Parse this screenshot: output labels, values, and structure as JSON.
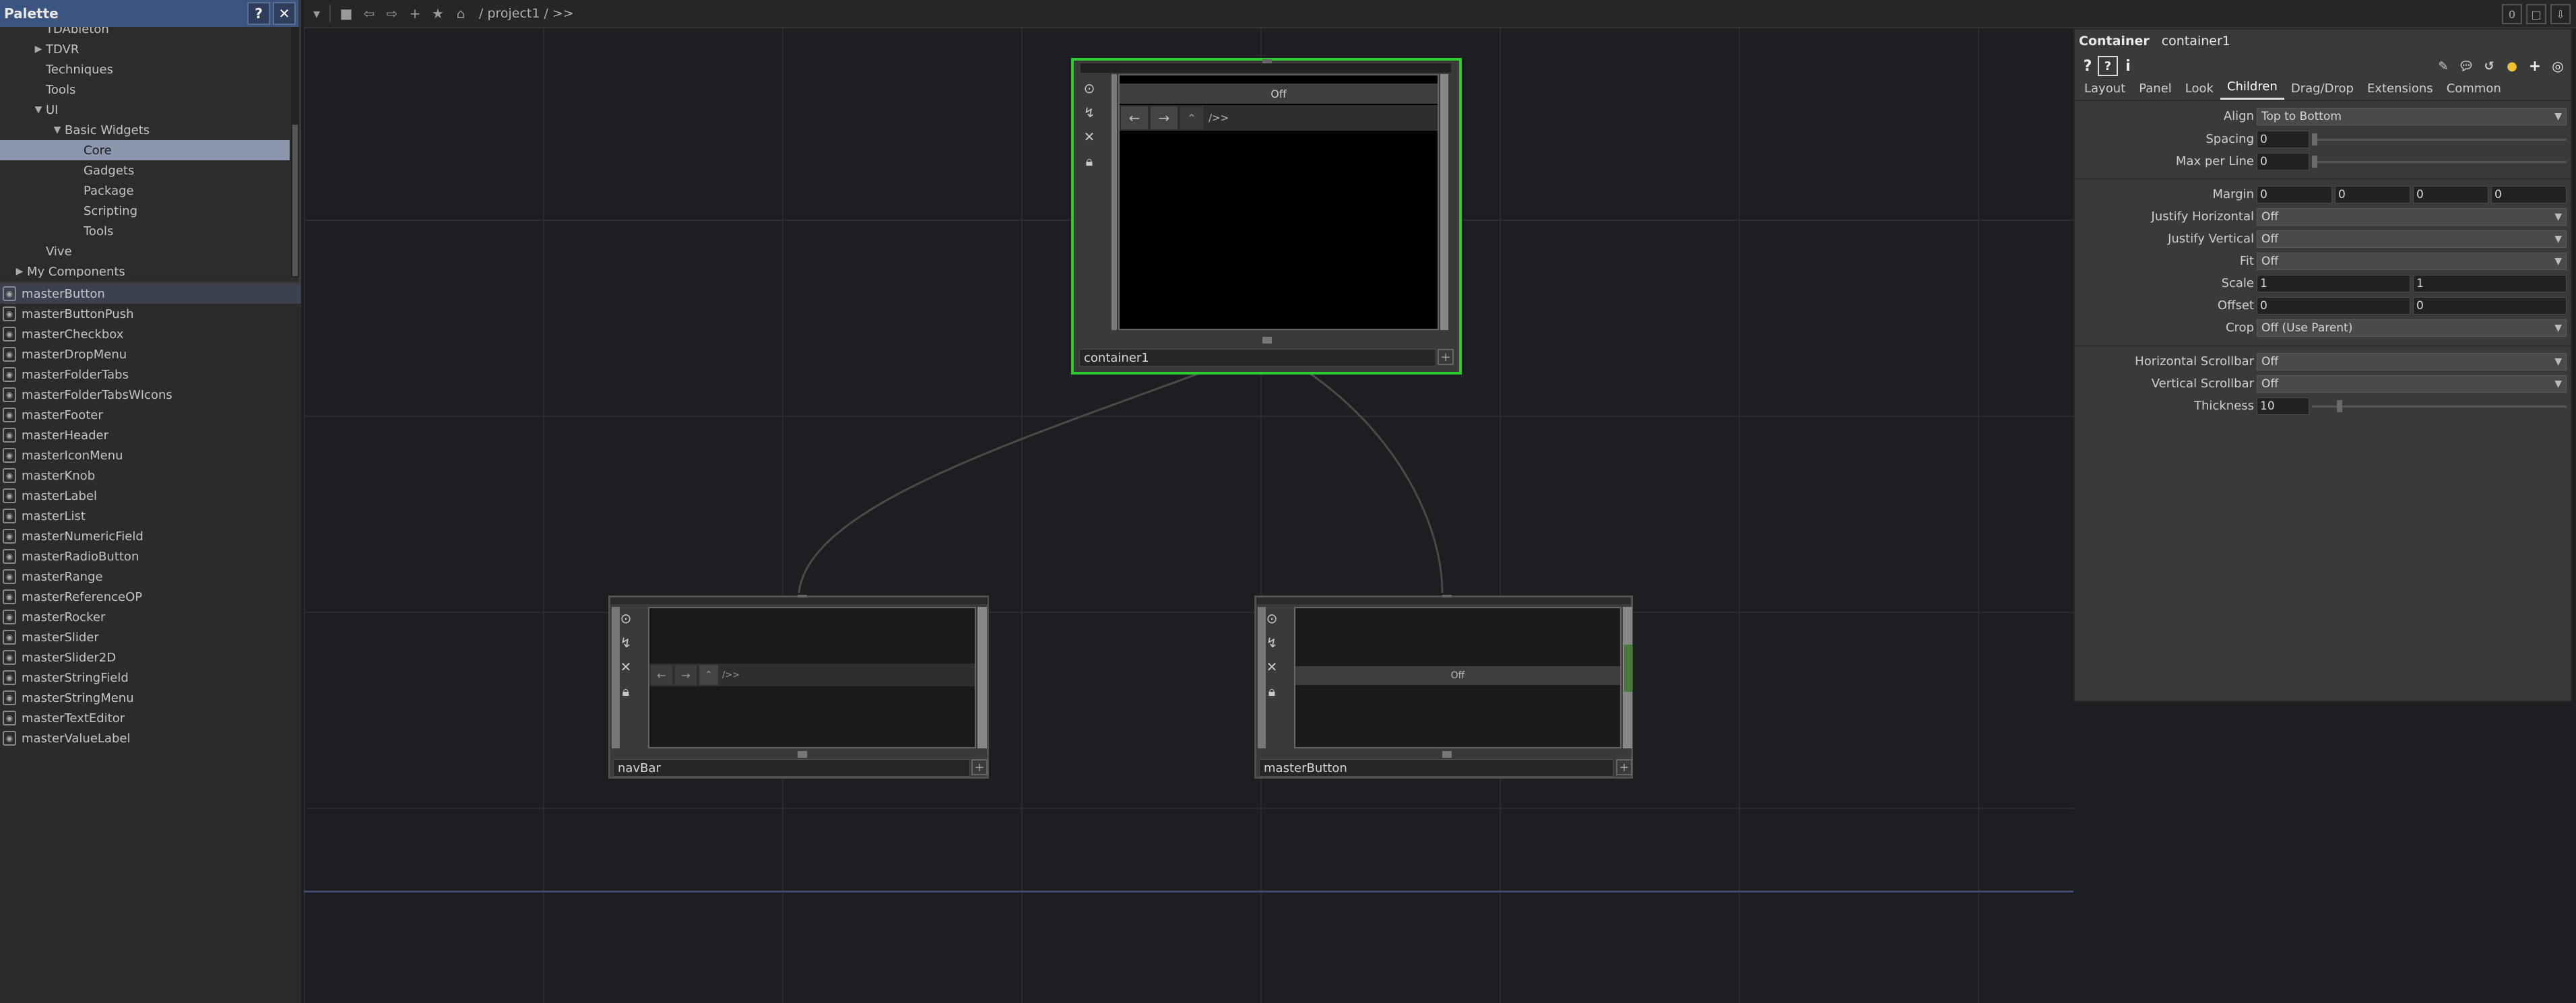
{
  "palette": {
    "title": "Palette",
    "help_label": "?",
    "close_label": "✕",
    "tree": [
      {
        "label": "TDAbleton",
        "indent": 1,
        "arrow": "",
        "selected": false
      },
      {
        "label": "TDVR",
        "indent": 1,
        "arrow": "▶",
        "selected": false
      },
      {
        "label": "Techniques",
        "indent": 1,
        "arrow": "",
        "selected": false
      },
      {
        "label": "Tools",
        "indent": 1,
        "arrow": "",
        "selected": false
      },
      {
        "label": "UI",
        "indent": 1,
        "arrow": "▼",
        "selected": false
      },
      {
        "label": "Basic Widgets",
        "indent": 2,
        "arrow": "▼",
        "selected": false
      },
      {
        "label": "Core",
        "indent": 3,
        "arrow": "",
        "selected": true
      },
      {
        "label": "Gadgets",
        "indent": 3,
        "arrow": "",
        "selected": false
      },
      {
        "label": "Package",
        "indent": 3,
        "arrow": "",
        "selected": false
      },
      {
        "label": "Scripting",
        "indent": 3,
        "arrow": "",
        "selected": false
      },
      {
        "label": "Tools",
        "indent": 3,
        "arrow": "",
        "selected": false
      },
      {
        "label": "Vive",
        "indent": 1,
        "arrow": "",
        "selected": false
      },
      {
        "label": "My Components",
        "indent": 0,
        "arrow": "▶",
        "selected": false
      }
    ],
    "components": [
      "masterButton",
      "masterButtonPush",
      "masterCheckbox",
      "masterDropMenu",
      "masterFolderTabs",
      "masterFolderTabsWIcons",
      "masterFooter",
      "masterHeader",
      "masterIconMenu",
      "masterKnob",
      "masterLabel",
      "masterList",
      "masterNumericField",
      "masterRadioButton",
      "masterRange",
      "masterReferenceOP",
      "masterRocker",
      "masterSlider",
      "masterSlider2D",
      "masterStringField",
      "masterStringMenu",
      "masterTextEditor",
      "masterValueLabel"
    ]
  },
  "toolbar": {
    "path": "/ project1 / >>",
    "right_buttons": [
      "0",
      "□",
      "⇩"
    ]
  },
  "network": {
    "nodes": {
      "container1": {
        "label": "container1",
        "viewer_text": "Off",
        "path_text": "/>>"
      },
      "navBar": {
        "label": "navBar",
        "path_text": "/>>"
      },
      "masterButton": {
        "label": "masterButton",
        "button_text": "Off"
      }
    }
  },
  "params": {
    "op_type": "Container",
    "op_name": "container1",
    "tabs": [
      "Layout",
      "Panel",
      "Look",
      "Children",
      "Drag/Drop",
      "Extensions",
      "Common"
    ],
    "active_tab": "Children",
    "rows": {
      "align": {
        "label": "Align",
        "value": "Top to Bottom"
      },
      "spacing": {
        "label": "Spacing",
        "value": "0",
        "fraction": 0
      },
      "max_per_line": {
        "label": "Max per Line",
        "value": "0",
        "fraction": 0
      },
      "margin": {
        "label": "Margin",
        "values": [
          "0",
          "0",
          "0",
          "0"
        ]
      },
      "justify_h": {
        "label": "Justify Horizontal",
        "value": "Off"
      },
      "justify_v": {
        "label": "Justify Vertical",
        "value": "Off"
      },
      "fit": {
        "label": "Fit",
        "value": "Off"
      },
      "scale": {
        "label": "Scale",
        "values": [
          "1",
          "1"
        ]
      },
      "offset": {
        "label": "Offset",
        "values": [
          "0",
          "0"
        ]
      },
      "crop": {
        "label": "Crop",
        "value": "Off (Use Parent)"
      },
      "h_scroll": {
        "label": "Horizontal Scrollbar",
        "value": "Off"
      },
      "v_scroll": {
        "label": "Vertical Scrollbar",
        "value": "Off"
      },
      "thickness": {
        "label": "Thickness",
        "value": "10",
        "fraction": 0.1
      }
    }
  },
  "colors": {
    "selected_node": "#2ecc2e",
    "palette_header": "#3c5580",
    "tree_selected": "#8c96ad"
  }
}
